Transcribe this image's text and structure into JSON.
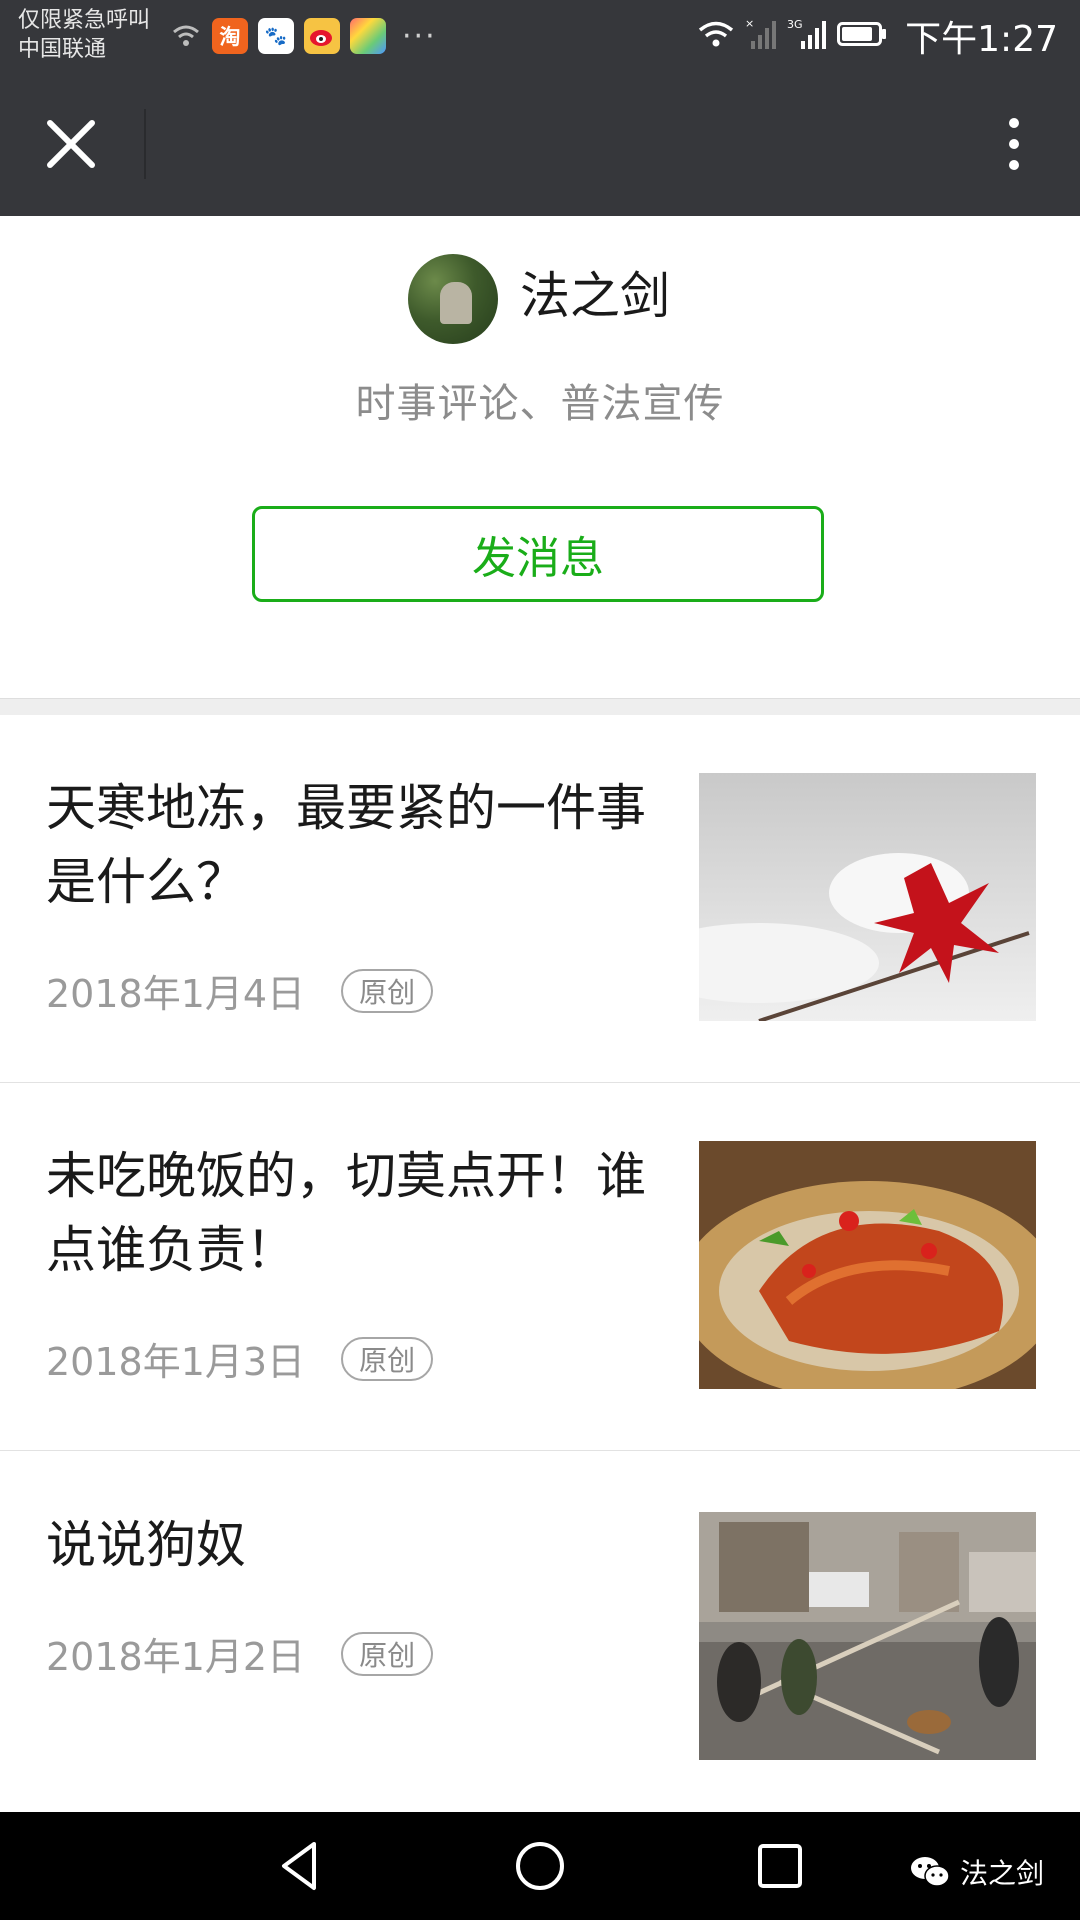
{
  "status_bar": {
    "carrier_line1": "仅限紧急呼叫",
    "carrier_line2": "中国联通",
    "app_icons": [
      "taobao-icon",
      "baidu-icon",
      "weibo-icon",
      "photos-icon"
    ],
    "network_label": "3G",
    "time": "下午1:27"
  },
  "nav": {
    "close_icon": "close-icon",
    "menu_icon": "more-vertical-icon"
  },
  "profile": {
    "name": "法之剑",
    "description": "时事评论、普法宣传",
    "message_button": "发消息",
    "accent_color": "#1aad19"
  },
  "articles": [
    {
      "title": "天寒地冻，最要紧的一件事是什么？",
      "date": "2018年1月4日",
      "badge": "原创",
      "thumbnail": "red maple leaf on snow"
    },
    {
      "title": "未吃晚饭的，切莫点开！谁点谁负责！",
      "date": "2018年1月3日",
      "badge": "原创",
      "thumbnail": "roast meat dish with peppers"
    },
    {
      "title": "说说狗奴",
      "date": "2018年1月2日",
      "badge": "原创",
      "thumbnail": "men chasing a dog on a street"
    }
  ],
  "system_nav": {
    "buttons": [
      "back-icon",
      "home-icon",
      "recents-icon"
    ],
    "watermark": "法之剑"
  }
}
